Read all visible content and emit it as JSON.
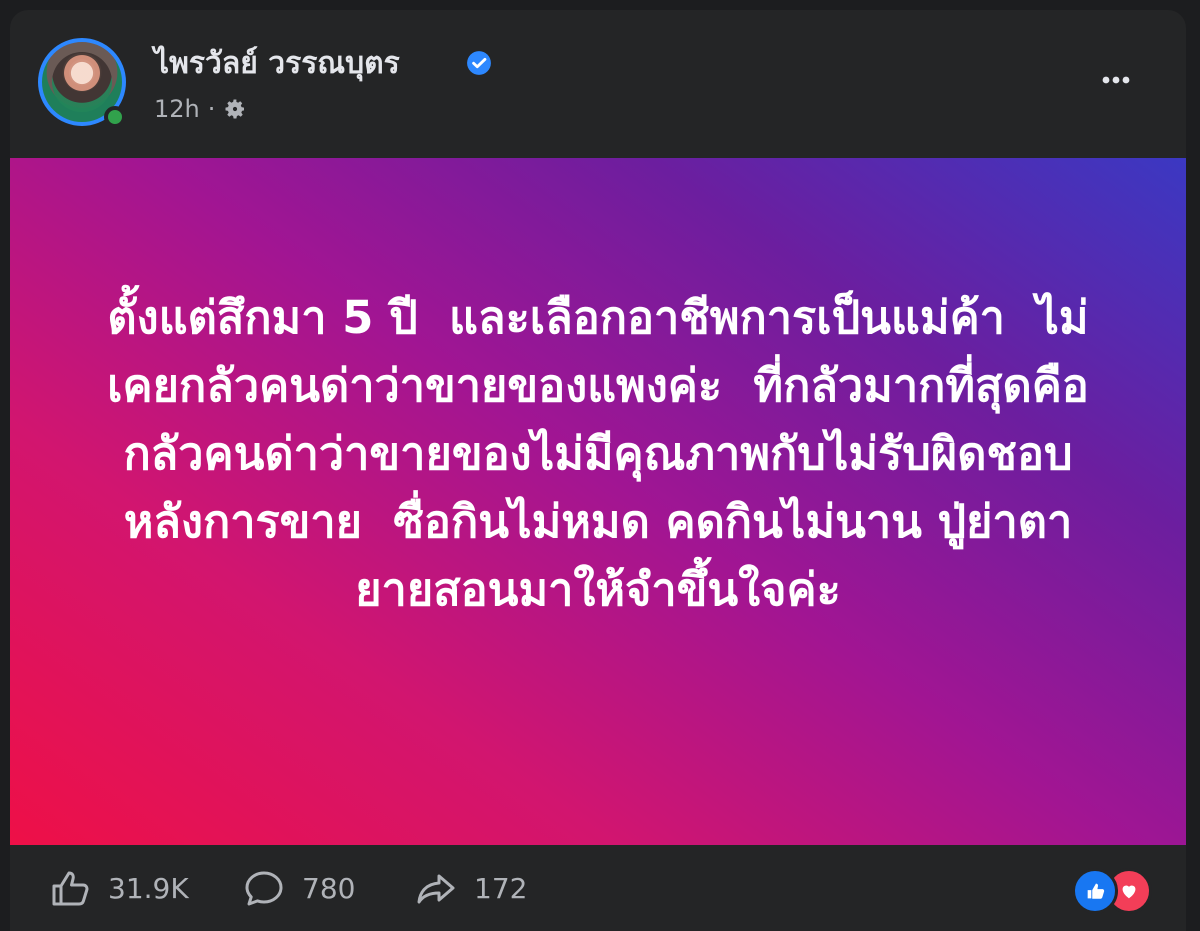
{
  "post": {
    "author_name": "ไพรวัลย์ วรรณบุตร",
    "timestamp": "12h",
    "separator": "·",
    "verified_icon": "verified-badge-icon",
    "privacy_icon": "gear-icon",
    "text": "ตั้งแต่สึกมา 5 ปี ￼ และเลือกอาชีพการเป็นแม่ค้า ￼ ไม่เคยกลัวคนด่าว่าขายของแพงค่ะ ￼ ที่กลัวมากที่สุดคือกลัวคนด่าว่าขายของไม่มีคุณภาพกับไม่รับผิดชอบหลังการขาย ￼ ซื่อกินไม่หมด คดกินไม่นาน ปู่ย่าตายายสอนมาให้จำขึ้นใจค่ะ",
    "background_gradient": [
      "#ee1047",
      "#d2156f",
      "#a11593",
      "#6c1e9f",
      "#3b38c2"
    ]
  },
  "actions": {
    "like_count": "31.9K",
    "comment_count": "780",
    "share_count": "172"
  },
  "colors": {
    "card_bg": "#242526",
    "text_primary": "#e4e6eb",
    "text_secondary": "#b0b3b8",
    "verified_blue": "#2d88ff",
    "online_green": "#31a24c",
    "like_blue": "#1877f2",
    "love_red": "#f33e58"
  }
}
